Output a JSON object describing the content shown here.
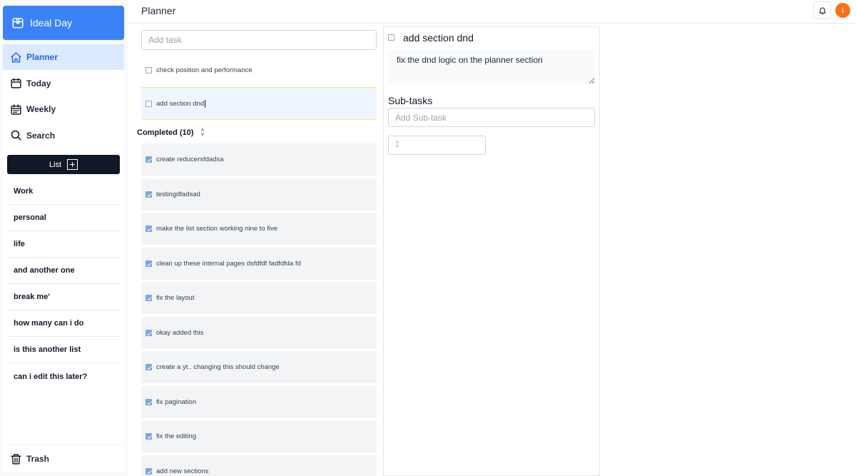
{
  "app": {
    "name": "Ideal Day"
  },
  "nav": [
    {
      "label": "Planner",
      "icon": "home-icon",
      "active": true
    },
    {
      "label": "Today",
      "icon": "calendar-icon"
    },
    {
      "label": "Weekly",
      "icon": "calendar-week-icon"
    },
    {
      "label": "Search",
      "icon": "search-icon"
    }
  ],
  "lists": {
    "button_label": "List",
    "items": [
      "Work",
      "personal",
      "life",
      "and another one",
      "break me'",
      "how many can i do",
      "is this another list",
      "can i edit this later?"
    ]
  },
  "trash": {
    "label": "Trash"
  },
  "header": {
    "title": "Planner",
    "avatar_initial": "I"
  },
  "tasks": {
    "add_placeholder": "Add task",
    "pending": [
      {
        "label": "check position and performance"
      },
      {
        "label": "add section dnd",
        "selected": true
      }
    ],
    "completed_label": "Completed (10)",
    "completed": [
      "create reducersfdadsa",
      "testingdfadsad",
      "make the list section working nine to five",
      "clean up these internal pages dsfdfdf fadfdfda fd",
      "fix the layout",
      "okay added this",
      "create a yt.. changing this should change",
      "fix pagination",
      "fix the editing",
      "add new sections"
    ]
  },
  "detail": {
    "title": "add section dnd",
    "description": "fix the dnd logic on the planner section",
    "subtasks_label": "Sub-tasks",
    "subtask_placeholder": "Add Sub-task"
  },
  "colors": {
    "accent": "#3b82f6",
    "active_bg": "#dbeafe",
    "avatar": "#f97316",
    "dark_button": "#111827"
  }
}
